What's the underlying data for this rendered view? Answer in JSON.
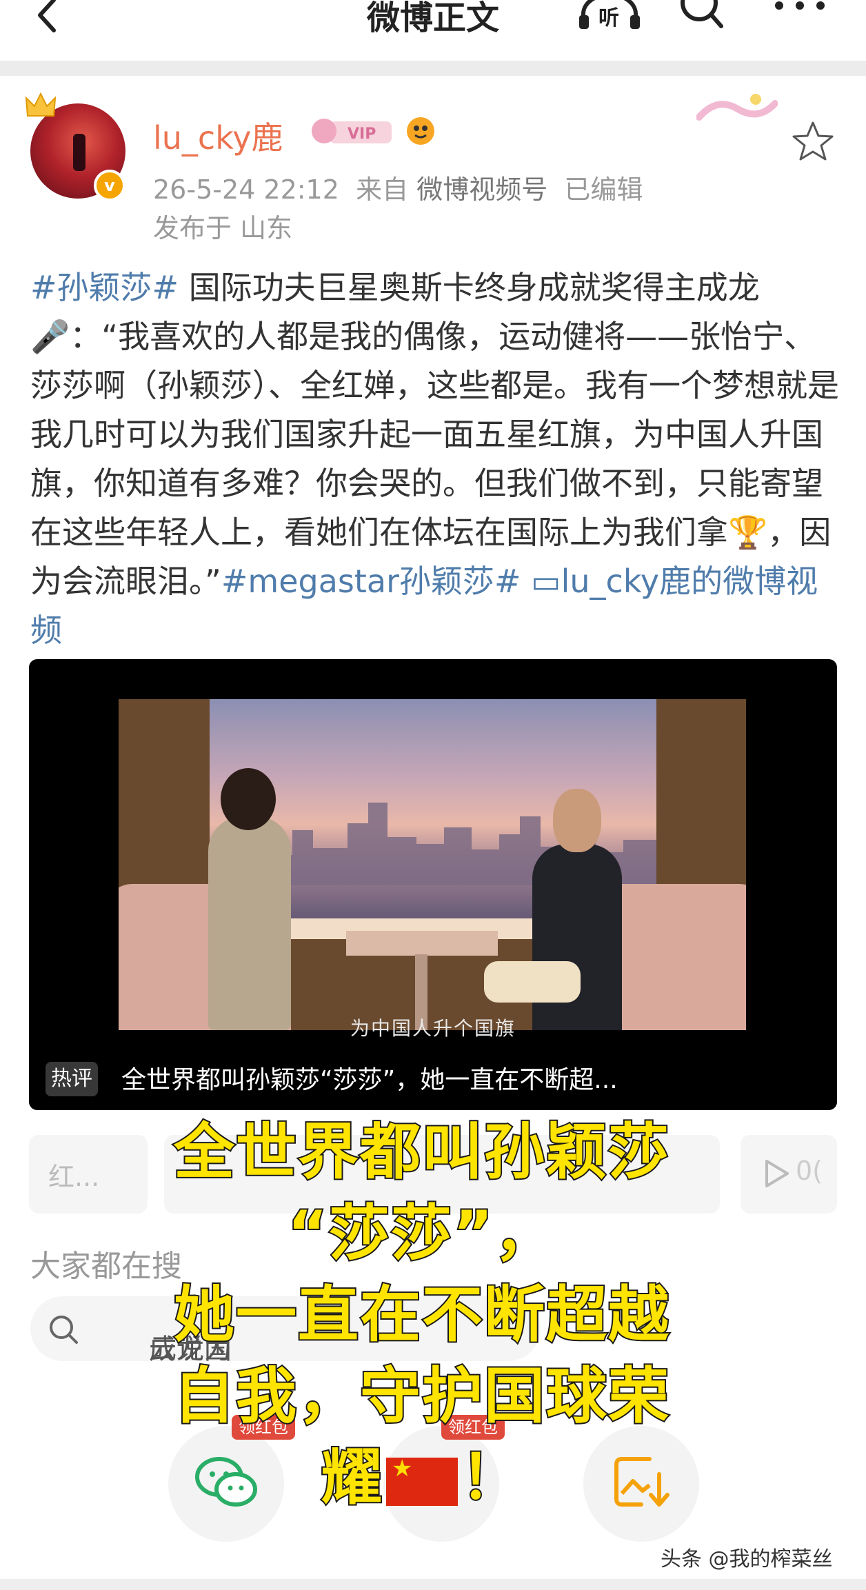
{
  "header": {
    "title": "微博正文",
    "listen_label": "听"
  },
  "post": {
    "username": "lu_cky鹿",
    "member_badge": "VIP",
    "verified_mark": "v",
    "time": "26-5-24 22:12",
    "source_prefix": "来自",
    "source": "微博视频号",
    "edited": "已编辑",
    "location": "发布于 山东",
    "content": {
      "hashtag1": "#孙颖莎#",
      "text1": " 国际功夫巨星奥斯卡终身成就奖得主成龙",
      "emoji_mic": "🎤",
      "text2": "：“我喜欢的人都是我的偶像，运动健将——张怡宁、莎莎啊（孙颖莎）、全红婵，这些都是。我有一个梦想就是我几时可以为我们国家升起一面五星红旗，为中国人升国旗，你知道有多难？你会哭的。但我们做不到，只能寄望在这些年轻人上，看她们在体坛在国际上为我们拿",
      "emoji_trophy": "🏆",
      "text3": "，因为会流眼泪。”",
      "hashtag2": "#megastar孙颖莎#",
      "video_link": " ▭lu_cky鹿的微博视频"
    }
  },
  "video": {
    "subtitle": "为中国人升个国旗",
    "hot_tag": "热评",
    "hot_comment": "全世界都叫孙颖莎“莎莎”，她一直在不断超..."
  },
  "actions": {
    "left_partial": "红...",
    "right_partial": "0("
  },
  "search_section": {
    "title": "大家都在搜",
    "query_partial": "成龙为",
    "query_partial_end": "云说国"
  },
  "share": {
    "redpacket1": "领红包",
    "redpacket2": "领红包"
  },
  "overlay": {
    "line1": "全世界都叫孙颖莎",
    "line2": "“莎莎”，",
    "line3": "她一直在不断超越",
    "line4": "自我，守护国球荣",
    "line5": "耀",
    "line5_end": "！"
  },
  "watermark": "头条 @我的榨菜丝",
  "colors": {
    "username": "#eb7350",
    "link": "#4f7cab",
    "overlay_text": "#ffe400",
    "verified": "#f6a400"
  }
}
